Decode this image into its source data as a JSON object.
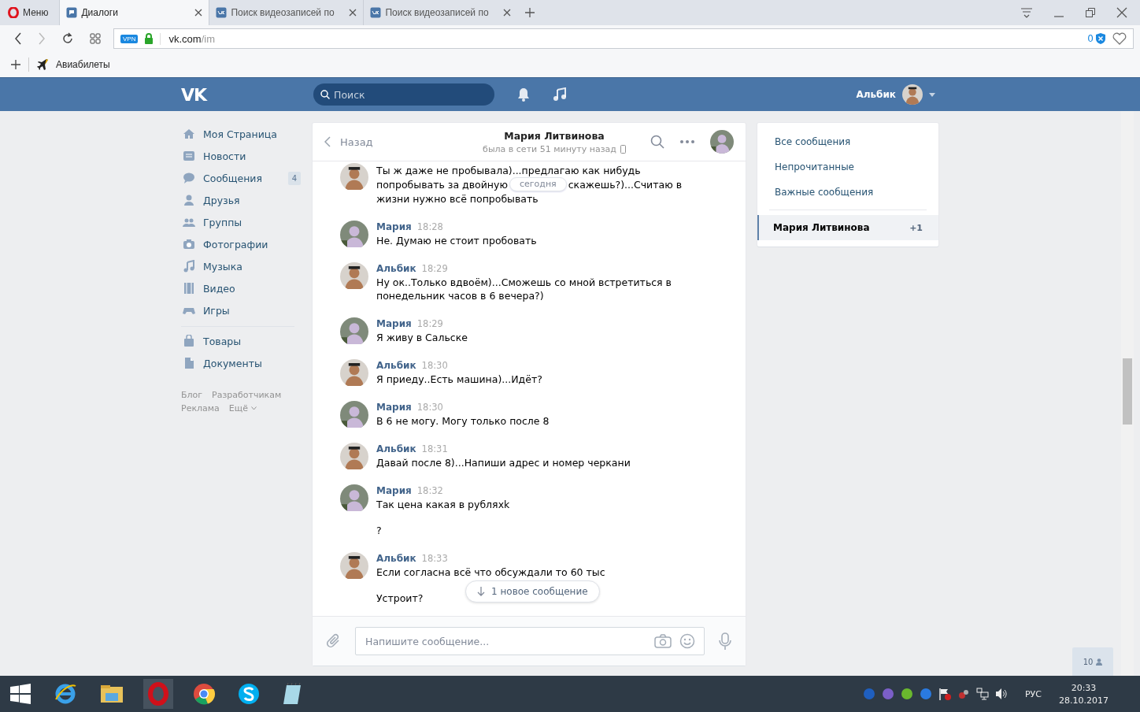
{
  "browser": {
    "menu_label": "Меню",
    "tabs": [
      {
        "title": "Диалоги",
        "selected": true
      },
      {
        "title": "Поиск видеозаписей по",
        "selected": false
      },
      {
        "title": "Поиск видеозаписей по",
        "selected": false
      }
    ],
    "address": {
      "badge": "VPN",
      "host": "vk.com",
      "path": "/im",
      "blocked_count": "0"
    },
    "bookmarks": [
      {
        "label": "Авиабилеты"
      }
    ]
  },
  "header": {
    "logo": "VK",
    "search_placeholder": "Поиск",
    "user_name": "Альбик"
  },
  "nav": {
    "groups": [
      [
        {
          "label": "Моя Страница"
        },
        {
          "label": "Новости"
        },
        {
          "label": "Сообщения",
          "badge": "4"
        },
        {
          "label": "Друзья"
        },
        {
          "label": "Группы"
        },
        {
          "label": "Фотографии"
        },
        {
          "label": "Музыка"
        },
        {
          "label": "Видео"
        },
        {
          "label": "Игры"
        }
      ],
      [
        {
          "label": "Товары"
        },
        {
          "label": "Документы"
        }
      ]
    ],
    "footer_links": [
      "Блог",
      "Разработчикам",
      "Реклама",
      "Ещё"
    ]
  },
  "chat": {
    "back_label": "Назад",
    "title": "Мария Литвинова",
    "status": "была в сети 51 минуту назад",
    "date_divider": "сегодня",
    "messages": [
      {
        "kind": "outgoing",
        "lines": [
          "Ты ж даже не пробывала)...предлагаю как нибудь",
          {
            "before": "попробывать за двойную",
            "after": "скажешь?)...Считаю в"
          },
          "жизни нужно всё попробывать"
        ]
      },
      {
        "kind": "incoming",
        "name": "Мария",
        "time": "18:28",
        "paragraphs": [
          "Не. Думаю не стоит пробовать"
        ]
      },
      {
        "kind": "outgoing",
        "name": "Альбик",
        "time": "18:29",
        "paragraphs": [
          "Ну ок..Только вдвоём)...Сможешь со мной встретиться в понедельник часов в 6 вечера?)"
        ]
      },
      {
        "kind": "incoming",
        "name": "Мария",
        "time": "18:29",
        "paragraphs": [
          "Я живу в Сальске"
        ]
      },
      {
        "kind": "outgoing",
        "name": "Альбик",
        "time": "18:30",
        "paragraphs": [
          "Я приеду..Есть машина)...Идёт?"
        ]
      },
      {
        "kind": "incoming",
        "name": "Мария",
        "time": "18:30",
        "paragraphs": [
          "В 6 не могу. Могу только после 8"
        ]
      },
      {
        "kind": "outgoing",
        "name": "Альбик",
        "time": "18:31",
        "paragraphs": [
          "Давай после 8)...Напиши адрес и номер черкани"
        ]
      },
      {
        "kind": "incoming",
        "name": "Мария",
        "time": "18:32",
        "paragraphs": [
          "Так цена какая в рубляхk",
          "?"
        ]
      },
      {
        "kind": "outgoing",
        "name": "Альбик",
        "time": "18:33",
        "paragraphs": [
          "Если согласна всё что обсуждали то 60 тыс",
          "Устроит?"
        ]
      }
    ],
    "new_messages_pill": "1 новое сообщение",
    "composer_placeholder": "Напишите сообщение..."
  },
  "filters": {
    "items": [
      {
        "label": "Все сообщения",
        "selected": false
      },
      {
        "label": "Непрочитанные",
        "selected": false
      },
      {
        "label": "Важные сообщения",
        "selected": false
      }
    ],
    "conversations": [
      {
        "label": "Мария Литвинова",
        "count": "+1",
        "selected": true
      }
    ]
  },
  "online_badge": "10",
  "taskbar": {
    "language": "РУС",
    "time": "20:33",
    "date": "28.10.2017"
  }
}
